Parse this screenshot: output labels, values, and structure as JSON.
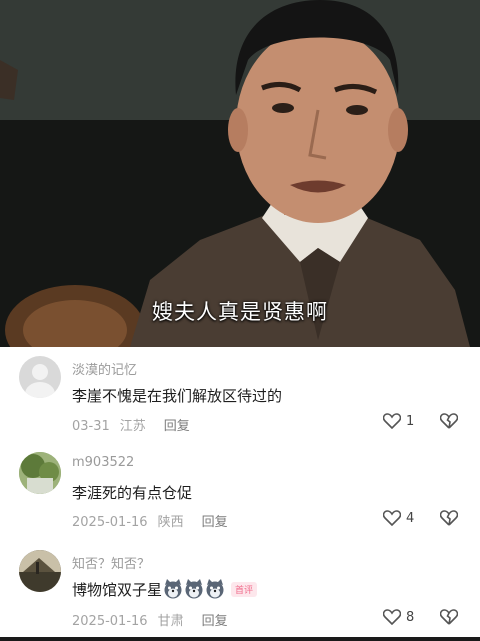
{
  "video": {
    "subtitle": "嫂夫人真是贤惠啊"
  },
  "comments": [
    {
      "username": "淡漠的记忆",
      "text": "李崖不愧是在我们解放区待过的",
      "date": "03-31",
      "location": "江苏",
      "reply_label": "回复",
      "likes": "1",
      "avatar": "default-avatar"
    },
    {
      "username": "m903522",
      "text": "李涯死的有点仓促",
      "date": "2025-01-16",
      "location": "陕西",
      "reply_label": "回复",
      "likes": "4",
      "avatar": "tree-photo-avatar"
    },
    {
      "username": "知否？知否？",
      "text": "博物馆双子星",
      "emojis": [
        "husky-emoji",
        "husky-emoji",
        "husky-emoji"
      ],
      "badge": "首评",
      "date": "2025-01-16",
      "location": "甘肃",
      "reply_label": "回复",
      "likes": "8",
      "avatar": "landscape-avatar"
    }
  ]
}
